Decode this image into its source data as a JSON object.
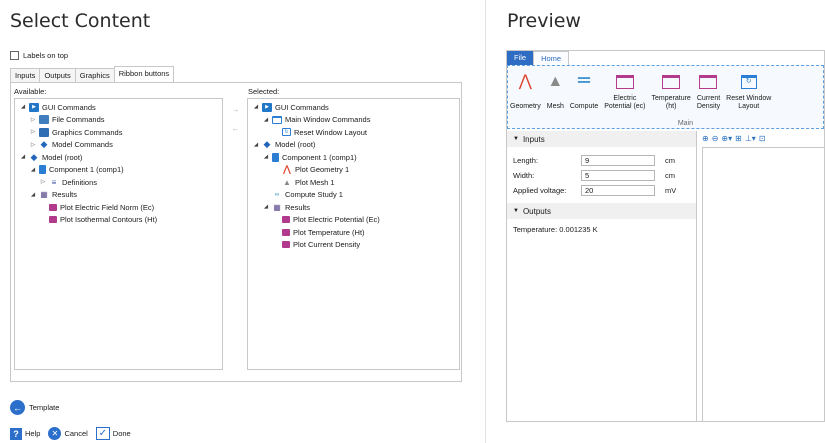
{
  "left": {
    "title": "Select Content",
    "labels_on_top": "Labels on top",
    "tabs": [
      "Inputs",
      "Outputs",
      "Graphics",
      "Ribbon buttons"
    ],
    "available_label": "Available:",
    "selected_label": "Selected:",
    "available_tree": [
      {
        "text": "GUI Commands",
        "indent": 0,
        "exp": "◢",
        "icon": "gui-commands-icon"
      },
      {
        "text": "File Commands",
        "indent": 1,
        "exp": "▷",
        "icon": "floppy-icon"
      },
      {
        "text": "Graphics Commands",
        "indent": 1,
        "exp": "▷",
        "icon": "graphics-icon"
      },
      {
        "text": "Model Commands",
        "indent": 1,
        "exp": "▷",
        "icon": "model-icon"
      },
      {
        "text": "Model (root)",
        "indent": 0,
        "exp": "◢",
        "icon": "model-icon"
      },
      {
        "text": "Component 1 (comp1)",
        "indent": 1,
        "exp": "◢",
        "icon": "component-icon"
      },
      {
        "text": "Definitions",
        "indent": 2,
        "exp": "▷",
        "icon": "definitions-icon"
      },
      {
        "text": "Results",
        "indent": 1,
        "exp": "◢",
        "icon": "results-icon"
      },
      {
        "text": "Plot Electric Field Norm (Ec)",
        "indent": 2,
        "exp": "",
        "icon": "plot-icon"
      },
      {
        "text": "Plot Isothermal Contours (Ht)",
        "indent": 2,
        "exp": "",
        "icon": "plot-icon"
      }
    ],
    "selected_tree": [
      {
        "text": "GUI Commands",
        "indent": 0,
        "exp": "◢",
        "icon": "gui-commands-icon"
      },
      {
        "text": "Main Window Commands",
        "indent": 1,
        "exp": "◢",
        "icon": "window-icon"
      },
      {
        "text": "Reset Window Layout",
        "indent": 2,
        "exp": "",
        "icon": "reset-icon"
      },
      {
        "text": "Model (root)",
        "indent": 0,
        "exp": "◢",
        "icon": "model-icon"
      },
      {
        "text": "Component 1 (comp1)",
        "indent": 1,
        "exp": "◢",
        "icon": "component-icon"
      },
      {
        "text": "Plot Geometry 1",
        "indent": 2,
        "exp": "",
        "icon": "geometry-icon"
      },
      {
        "text": "Plot Mesh 1",
        "indent": 2,
        "exp": "",
        "icon": "mesh-icon"
      },
      {
        "text": "Compute Study 1",
        "indent": 1,
        "exp": "",
        "icon": "compute-icon"
      },
      {
        "text": "Results",
        "indent": 1,
        "exp": "◢",
        "icon": "results-icon"
      },
      {
        "text": "Plot Electric Potential (Ec)",
        "indent": 2,
        "exp": "",
        "icon": "plot-icon"
      },
      {
        "text": "Plot Temperature (Ht)",
        "indent": 2,
        "exp": "",
        "icon": "plot-icon"
      },
      {
        "text": "Plot Current Density",
        "indent": 2,
        "exp": "",
        "icon": "plot-icon"
      }
    ],
    "template": "Template",
    "help": "Help",
    "cancel": "Cancel",
    "done": "Done"
  },
  "right": {
    "title": "Preview",
    "ribbon_tabs": {
      "file": "File",
      "home": "Home"
    },
    "ribbon_items": [
      {
        "l1": "",
        "l2": "Geometry",
        "icon": "geometry-icon"
      },
      {
        "l1": "",
        "l2": "Mesh",
        "icon": "mesh-icon"
      },
      {
        "l1": "",
        "l2": "Compute",
        "icon": "compute-icon"
      },
      {
        "l1": "Electric",
        "l2": "Potential (ec)",
        "icon": "plot-icon"
      },
      {
        "l1": "Temperature",
        "l2": "(ht)",
        "icon": "plot-icon"
      },
      {
        "l1": "Current",
        "l2": "Density",
        "icon": "plot-icon"
      },
      {
        "l1": "Reset Window",
        "l2": "Layout",
        "icon": "reset-icon"
      }
    ],
    "ribbon_group": "Main",
    "inputs_header": "Inputs",
    "inputs": [
      {
        "label": "Length:",
        "value": "9",
        "unit": "cm"
      },
      {
        "label": "Width:",
        "value": "5",
        "unit": "cm"
      },
      {
        "label": "Applied voltage:",
        "value": "20",
        "unit": "mV"
      }
    ],
    "outputs_header": "Outputs",
    "temperature_label": "Temperature:",
    "temperature_value": "0.001235 K"
  },
  "colors": {
    "accent": "#2c6fcb",
    "plot": "#b23a8c",
    "ribbon_border": "#5d9fe0"
  }
}
